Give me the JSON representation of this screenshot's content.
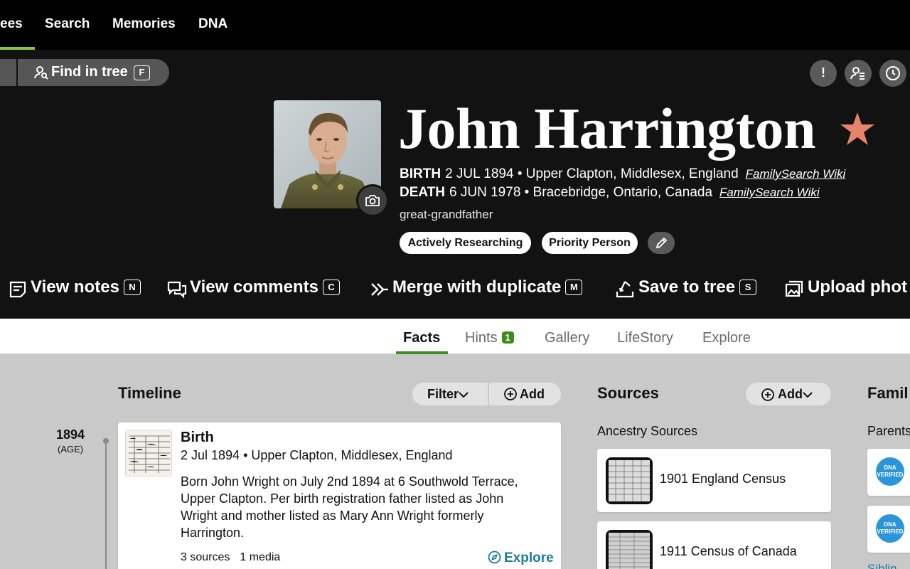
{
  "nav": {
    "items": [
      "ees",
      "Search",
      "Memories",
      "DNA"
    ]
  },
  "header": {
    "find_in_tree": {
      "label": "Find in tree",
      "shortcut": "F"
    },
    "name": "John Harrington",
    "birth": {
      "label": "BIRTH",
      "value": "2 JUL 1894 • Upper Clapton, Middlesex, England",
      "link": "FamilySearch Wiki"
    },
    "death": {
      "label": "DEATH",
      "value": "6 JUN 1978 • Bracebridge, Ontario, Canada",
      "link": "FamilySearch Wiki"
    },
    "relation": "great-grandfather",
    "badges": [
      "Actively Researching",
      "Priority Person"
    ],
    "alert_icon_text": "!",
    "star_color": "#e8836b"
  },
  "actions": [
    {
      "label": "View notes",
      "key": "N"
    },
    {
      "label": "View comments",
      "key": "C"
    },
    {
      "label": "Merge with duplicate",
      "key": "M"
    },
    {
      "label": "Save to tree",
      "key": "S"
    },
    {
      "label": "Upload phot",
      "key": ""
    }
  ],
  "tabs": {
    "facts": "Facts",
    "hints": "Hints",
    "hints_count": "1",
    "gallery": "Gallery",
    "lifestory": "LifeStory",
    "explore": "Explore"
  },
  "timeline": {
    "title": "Timeline",
    "filter": "Filter",
    "add": "Add",
    "year": "1894",
    "age": "(AGE)",
    "event": {
      "title": "Birth",
      "date": "2 Jul 1894 • Upper Clapton, Middlesex, England",
      "description": "Born John Wright on July 2nd 1894 at 6 Southwold Terrace, Upper Clapton. Per birth registration father listed as John Wright and mother listed as Mary Ann Wright formerly Harrington.",
      "sources": "3 sources",
      "media": "1 media",
      "explore": "Explore"
    }
  },
  "sources": {
    "title": "Sources",
    "add": "Add",
    "subtitle": "Ancestry Sources",
    "items": [
      "1901 England Census",
      "1911 Census of Canada"
    ]
  },
  "family": {
    "title": "Famil",
    "parents": "Parents",
    "dna_badge": "DNA VERIFIED",
    "siblings": "Siblin"
  },
  "colors": {
    "accent_green": "#3d8b1d",
    "link_blue": "#1f7a9e",
    "dna_blue": "#2c95d9"
  }
}
